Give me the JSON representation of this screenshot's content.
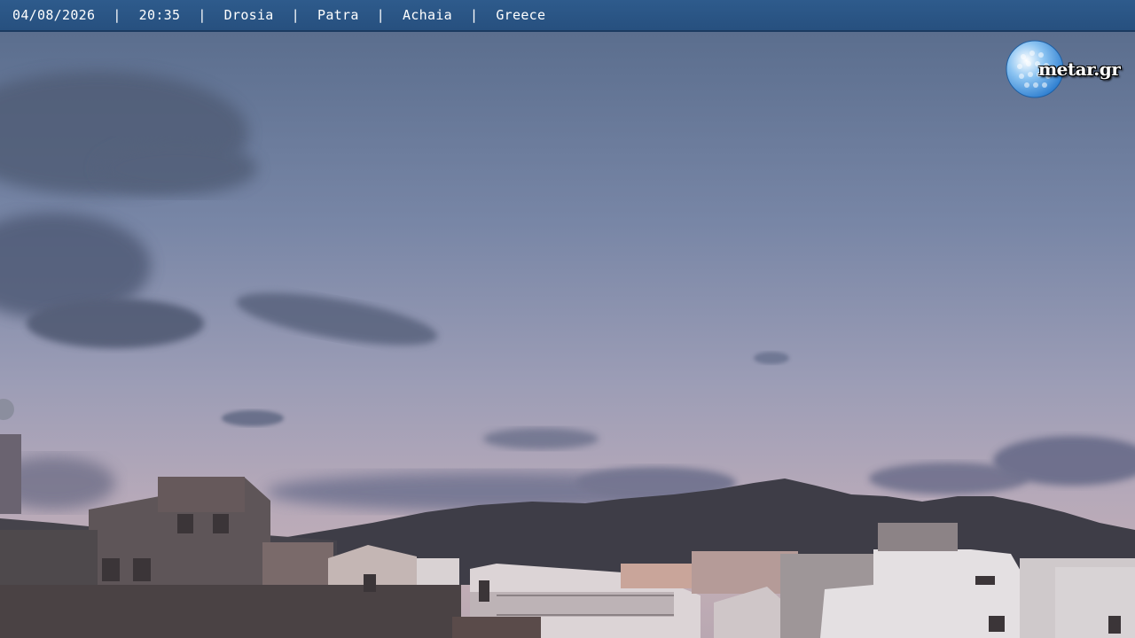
{
  "overlay": {
    "date": "04/08/2026",
    "time": "20:35",
    "village": "Drosia",
    "city": "Patra",
    "region": "Achaia",
    "country": "Greece",
    "separator": "|"
  },
  "logo": {
    "text": "metar.gr",
    "icon": "golf-ball-globe-icon"
  },
  "colors": {
    "bar": "#2b5687",
    "sky_top": "#5a6d8c",
    "sky_horizon": "#bca8b5",
    "mountains": "#3d3c45",
    "buildings_light": "#d9d3d6"
  }
}
